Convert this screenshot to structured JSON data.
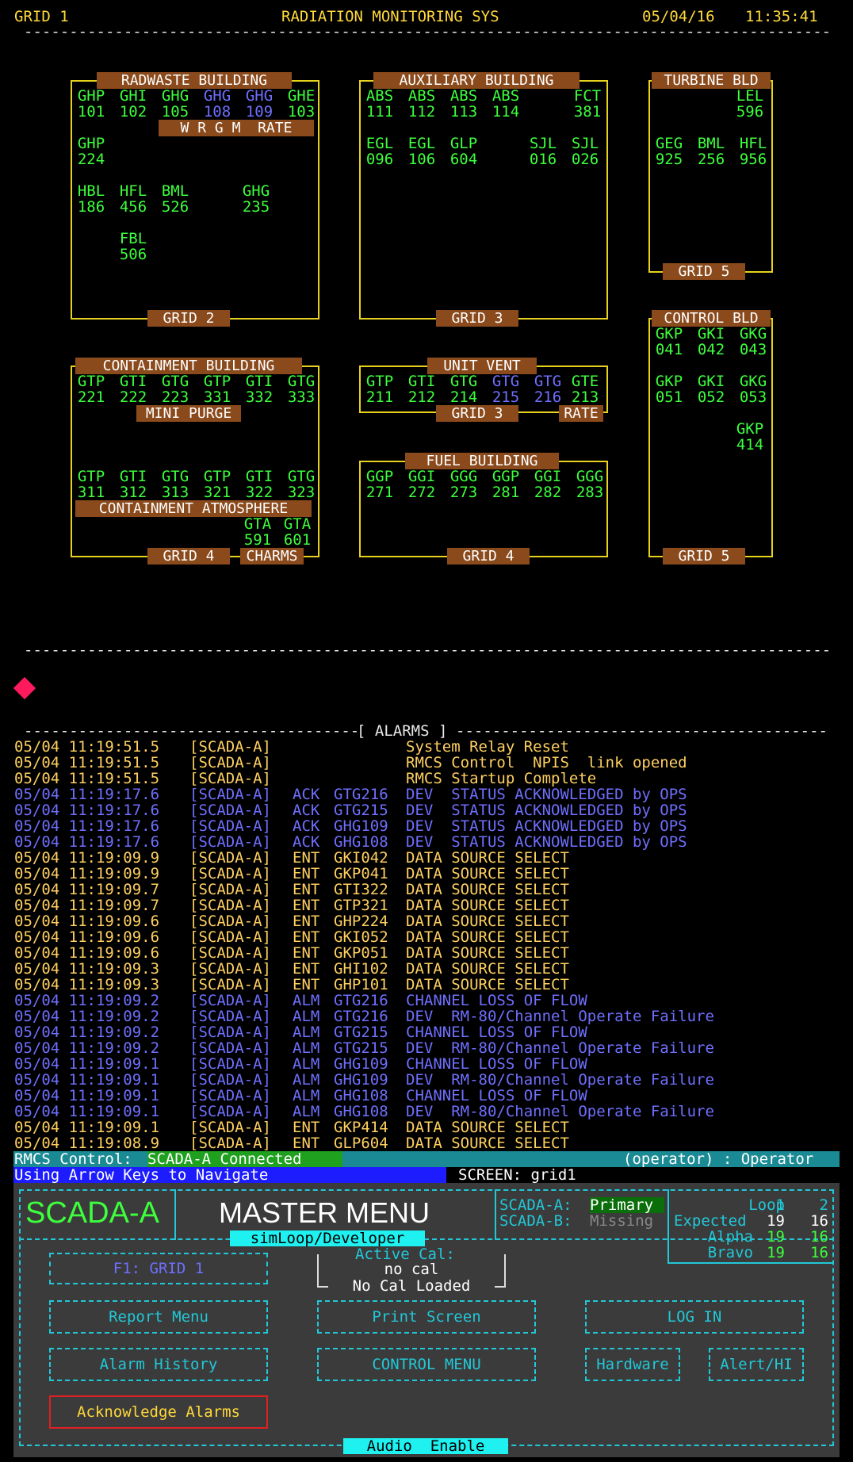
{
  "header": {
    "grid": "GRID 1",
    "system": "RADIATION MONITORING SYS",
    "date": "05/04/16",
    "time": "11:35:41"
  },
  "colors": {
    "green": "#3dff3d",
    "blue": "#6f6fff",
    "yellow": "#ffd060",
    "cyan": "#21c8d8",
    "label_bg": "#8a4a1c",
    "box_border": "#e8d21e"
  },
  "buildings": {
    "radwaste": {
      "title": "RADWASTE BUILDING",
      "grid": "GRID 2",
      "band": "W R G M  RATE",
      "r1": [
        [
          "GHP",
          "101",
          "g"
        ],
        [
          "GHI",
          "102",
          "g"
        ],
        [
          "GHG",
          "105",
          "g"
        ],
        [
          "GHG",
          "108",
          "b"
        ],
        [
          "GHG",
          "109",
          "b"
        ],
        [
          "GHE",
          "103",
          "g"
        ]
      ],
      "r2": [
        [
          "GHP",
          "224",
          "g"
        ]
      ],
      "r3": [
        [
          "HBL",
          "186",
          "g"
        ],
        [
          "HFL",
          "456",
          "g"
        ],
        [
          "BML",
          "526",
          "g"
        ],
        [
          "GHG",
          "235",
          "g"
        ]
      ],
      "r4": [
        [
          "FBL",
          "506",
          "g"
        ]
      ]
    },
    "auxiliary": {
      "title": "AUXILIARY BUILDING",
      "grid": "GRID 3",
      "r1": [
        [
          "ABS",
          "111",
          "g"
        ],
        [
          "ABS",
          "112",
          "g"
        ],
        [
          "ABS",
          "113",
          "g"
        ],
        [
          "ABS",
          "114",
          "g"
        ],
        [
          "FCT",
          "381",
          "g"
        ]
      ],
      "r2": [
        [
          "EGL",
          "096",
          "g"
        ],
        [
          "EGL",
          "106",
          "g"
        ],
        [
          "GLP",
          "604",
          "g"
        ],
        [
          "SJL",
          "016",
          "g"
        ],
        [
          "SJL",
          "026",
          "g"
        ]
      ]
    },
    "turbine": {
      "title": "TURBINE BLD",
      "grid": "GRID 5",
      "r1": [
        [
          "LEL",
          "596",
          "g"
        ]
      ],
      "r2": [
        [
          "GEG",
          "925",
          "g"
        ],
        [
          "BML",
          "256",
          "g"
        ],
        [
          "HFL",
          "956",
          "g"
        ]
      ]
    },
    "containment": {
      "title": "CONTAINMENT BUILDING",
      "grid": "GRID 4",
      "band1": "MINI PURGE",
      "band2": "CONTAINMENT ATMOSPHERE",
      "charms": "CHARMS",
      "r1": [
        [
          "GTP",
          "221",
          "g"
        ],
        [
          "GTI",
          "222",
          "g"
        ],
        [
          "GTG",
          "223",
          "g"
        ],
        [
          "GTP",
          "331",
          "g"
        ],
        [
          "GTI",
          "332",
          "g"
        ],
        [
          "GTG",
          "333",
          "g"
        ]
      ],
      "r2": [
        [
          "GTP",
          "311",
          "g"
        ],
        [
          "GTI",
          "312",
          "g"
        ],
        [
          "GTG",
          "313",
          "g"
        ],
        [
          "GTP",
          "321",
          "g"
        ],
        [
          "GTI",
          "322",
          "g"
        ],
        [
          "GTG",
          "323",
          "g"
        ]
      ],
      "r3": [
        [
          "GTA",
          "591",
          "g"
        ],
        [
          "GTA",
          "601",
          "g"
        ]
      ]
    },
    "unitvent": {
      "title": "UNIT VENT",
      "grid": "GRID 3",
      "rate": "RATE",
      "r1": [
        [
          "GTP",
          "211",
          "g"
        ],
        [
          "GTI",
          "212",
          "g"
        ],
        [
          "GTG",
          "214",
          "g"
        ],
        [
          "GTG",
          "215",
          "b"
        ],
        [
          "GTG",
          "216",
          "b"
        ],
        [
          "GTE",
          "213",
          "g"
        ]
      ]
    },
    "fuel": {
      "title": "FUEL BUILDING",
      "grid": "GRID 4",
      "r1": [
        [
          "GGP",
          "271",
          "g"
        ],
        [
          "GGI",
          "272",
          "g"
        ],
        [
          "GGG",
          "273",
          "g"
        ],
        [
          "GGP",
          "281",
          "g"
        ],
        [
          "GGI",
          "282",
          "g"
        ],
        [
          "GGG",
          "283",
          "g"
        ]
      ]
    },
    "control": {
      "title": "CONTROL BLD",
      "grid": "GRID 5",
      "r1": [
        [
          "GKP",
          "041",
          "g"
        ],
        [
          "GKI",
          "042",
          "g"
        ],
        [
          "GKG",
          "043",
          "g"
        ]
      ],
      "r2": [
        [
          "GKP",
          "051",
          "g"
        ],
        [
          "GKI",
          "052",
          "g"
        ],
        [
          "GKG",
          "053",
          "g"
        ]
      ],
      "r3": [
        [
          "GKP",
          "414",
          "g"
        ]
      ]
    }
  },
  "alarms_title": "[ ALARMS ]",
  "alarms": [
    {
      "ts": "05/04 11:19:51.5",
      "src": "[SCADA-A]",
      "act": "",
      "tag": "",
      "msg": "System Relay Reset",
      "c": "y"
    },
    {
      "ts": "05/04 11:19:51.5",
      "src": "[SCADA-A]",
      "act": "",
      "tag": "",
      "msg": "RMCS Control  NPIS  link opened",
      "c": "y"
    },
    {
      "ts": "05/04 11:19:51.5",
      "src": "[SCADA-A]",
      "act": "",
      "tag": "",
      "msg": "RMCS Startup Complete",
      "c": "y"
    },
    {
      "ts": "05/04 11:19:17.6",
      "src": "[SCADA-A]",
      "act": "ACK",
      "tag": "GTG216",
      "msg": "DEV  STATUS ACKNOWLEDGED by OPS",
      "c": "b"
    },
    {
      "ts": "05/04 11:19:17.6",
      "src": "[SCADA-A]",
      "act": "ACK",
      "tag": "GTG215",
      "msg": "DEV  STATUS ACKNOWLEDGED by OPS",
      "c": "b"
    },
    {
      "ts": "05/04 11:19:17.6",
      "src": "[SCADA-A]",
      "act": "ACK",
      "tag": "GHG109",
      "msg": "DEV  STATUS ACKNOWLEDGED by OPS",
      "c": "b"
    },
    {
      "ts": "05/04 11:19:17.6",
      "src": "[SCADA-A]",
      "act": "ACK",
      "tag": "GHG108",
      "msg": "DEV  STATUS ACKNOWLEDGED by OPS",
      "c": "b"
    },
    {
      "ts": "05/04 11:19:09.9",
      "src": "[SCADA-A]",
      "act": "ENT",
      "tag": "GKI042",
      "msg": "DATA SOURCE SELECT",
      "c": "y"
    },
    {
      "ts": "05/04 11:19:09.9",
      "src": "[SCADA-A]",
      "act": "ENT",
      "tag": "GKP041",
      "msg": "DATA SOURCE SELECT",
      "c": "y"
    },
    {
      "ts": "05/04 11:19:09.7",
      "src": "[SCADA-A]",
      "act": "ENT",
      "tag": "GTI322",
      "msg": "DATA SOURCE SELECT",
      "c": "y"
    },
    {
      "ts": "05/04 11:19:09.7",
      "src": "[SCADA-A]",
      "act": "ENT",
      "tag": "GTP321",
      "msg": "DATA SOURCE SELECT",
      "c": "y"
    },
    {
      "ts": "05/04 11:19:09.6",
      "src": "[SCADA-A]",
      "act": "ENT",
      "tag": "GHP224",
      "msg": "DATA SOURCE SELECT",
      "c": "y"
    },
    {
      "ts": "05/04 11:19:09.6",
      "src": "[SCADA-A]",
      "act": "ENT",
      "tag": "GKI052",
      "msg": "DATA SOURCE SELECT",
      "c": "y"
    },
    {
      "ts": "05/04 11:19:09.6",
      "src": "[SCADA-A]",
      "act": "ENT",
      "tag": "GKP051",
      "msg": "DATA SOURCE SELECT",
      "c": "y"
    },
    {
      "ts": "05/04 11:19:09.3",
      "src": "[SCADA-A]",
      "act": "ENT",
      "tag": "GHI102",
      "msg": "DATA SOURCE SELECT",
      "c": "y"
    },
    {
      "ts": "05/04 11:19:09.3",
      "src": "[SCADA-A]",
      "act": "ENT",
      "tag": "GHP101",
      "msg": "DATA SOURCE SELECT",
      "c": "y"
    },
    {
      "ts": "05/04 11:19:09.2",
      "src": "[SCADA-A]",
      "act": "ALM",
      "tag": "GTG216",
      "msg": "CHANNEL LOSS OF FLOW",
      "c": "b"
    },
    {
      "ts": "05/04 11:19:09.2",
      "src": "[SCADA-A]",
      "act": "ALM",
      "tag": "GTG216",
      "msg": "DEV  RM-80/Channel Operate Failure",
      "c": "b"
    },
    {
      "ts": "05/04 11:19:09.2",
      "src": "[SCADA-A]",
      "act": "ALM",
      "tag": "GTG215",
      "msg": "CHANNEL LOSS OF FLOW",
      "c": "b"
    },
    {
      "ts": "05/04 11:19:09.2",
      "src": "[SCADA-A]",
      "act": "ALM",
      "tag": "GTG215",
      "msg": "DEV  RM-80/Channel Operate Failure",
      "c": "b"
    },
    {
      "ts": "05/04 11:19:09.1",
      "src": "[SCADA-A]",
      "act": "ALM",
      "tag": "GHG109",
      "msg": "CHANNEL LOSS OF FLOW",
      "c": "b"
    },
    {
      "ts": "05/04 11:19:09.1",
      "src": "[SCADA-A]",
      "act": "ALM",
      "tag": "GHG109",
      "msg": "DEV  RM-80/Channel Operate Failure",
      "c": "b"
    },
    {
      "ts": "05/04 11:19:09.1",
      "src": "[SCADA-A]",
      "act": "ALM",
      "tag": "GHG108",
      "msg": "CHANNEL LOSS OF FLOW",
      "c": "b"
    },
    {
      "ts": "05/04 11:19:09.1",
      "src": "[SCADA-A]",
      "act": "ALM",
      "tag": "GHG108",
      "msg": "DEV  RM-80/Channel Operate Failure",
      "c": "b"
    },
    {
      "ts": "05/04 11:19:09.1",
      "src": "[SCADA-A]",
      "act": "ENT",
      "tag": "GKP414",
      "msg": "DATA SOURCE SELECT",
      "c": "y"
    },
    {
      "ts": "05/04 11:19:08.9",
      "src": "[SCADA-A]",
      "act": "ENT",
      "tag": "GLP604",
      "msg": "DATA SOURCE SELECT",
      "c": "y"
    }
  ],
  "status": {
    "rmcs_label": "RMCS Control:",
    "rmcs_value": "SCADA-A Connected",
    "operator": "(operator) : Operator",
    "nav_hint": "Using Arrow Keys to Navigate",
    "screen": "SCREEN: grid1"
  },
  "menu": {
    "brand": "SCADA-A",
    "title": "MASTER MENU",
    "subtitle": "simLoop/Developer",
    "scada_a_label": "SCADA-A:",
    "scada_a_value": "Primary",
    "scada_b_label": "SCADA-B:",
    "scada_b_value": "Missing",
    "loop_label": "Loop",
    "loop_1": "1",
    "loop_2": "2",
    "expected_label": "Expected",
    "expected_1": "19",
    "expected_2": "16",
    "alpha_label": "Alpha",
    "alpha_1": "19",
    "alpha_2": "16",
    "bravo_label": "Bravo",
    "bravo_1": "19",
    "bravo_2": "16",
    "f1": "F1:   GRID 1",
    "active_cal_label": "Active Cal:",
    "active_cal_value": "no cal",
    "cal_loaded": "No Cal Loaded",
    "report_menu": "Report  Menu",
    "print_screen": "Print Screen",
    "log_in": "LOG IN",
    "alarm_history": "Alarm  History",
    "control_menu": "CONTROL MENU",
    "hardware": "Hardware",
    "alert_hi": "Alert/HI",
    "ack_alarms": "Acknowledge Alarms",
    "audio": "Audio  Enable"
  }
}
